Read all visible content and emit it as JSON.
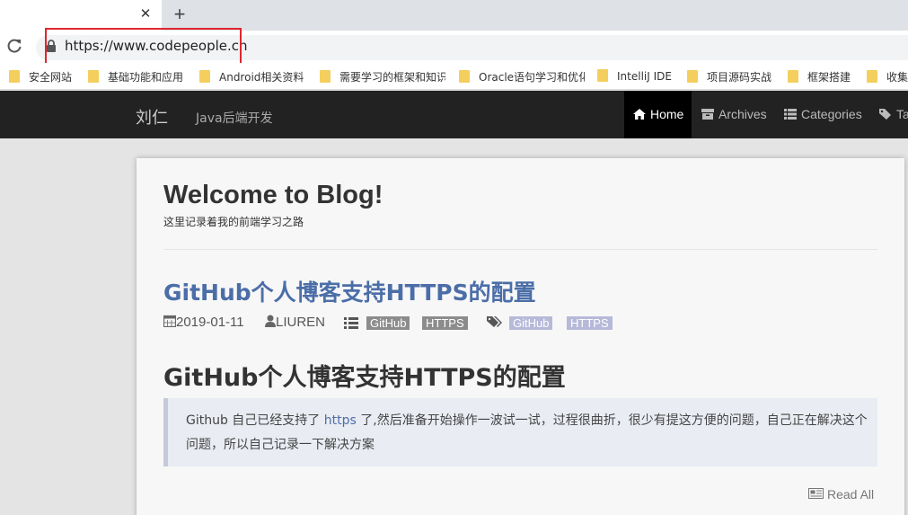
{
  "browser": {
    "tab_close": "✕",
    "new_tab": "+",
    "url": "https://www.codepeople.cn",
    "bookmarks": [
      {
        "label": "安全网站"
      },
      {
        "label": "基础功能和应用"
      },
      {
        "label": "Android相关资料"
      },
      {
        "label": "需要学习的框架和知识"
      },
      {
        "label": "Oracle语句学习和优化"
      },
      {
        "label": "IntelliJ IDE"
      },
      {
        "label": "项目源码实战"
      },
      {
        "label": "框架搭建"
      },
      {
        "label": "收集"
      }
    ]
  },
  "site": {
    "brand": "刘仁",
    "tagline": "Java后端开发",
    "nav": {
      "home": "Home",
      "archives": "Archives",
      "categories": "Categories",
      "tags": "Ta"
    }
  },
  "main": {
    "title": "Welcome to Blog!",
    "subtitle": "这里记录着我的前端学习之路",
    "post": {
      "title": "GitHub个人博客支持HTTPS的配置",
      "date": "2019-01-11",
      "author": "LIUREN",
      "categories": [
        "GitHub",
        "HTTPS"
      ],
      "tags": [
        "GitHub",
        "HTTPS"
      ],
      "heading": "GitHub个人博客支持HTTPS的配置",
      "quote_before": "Github 自己已经支持了 ",
      "quote_link": "https",
      "quote_after": " 了,然后准备开始操作一波试一试，过程很曲折，很少有提这方便的问题，自己正在解决这个问题，所以自己记录一下解决方案",
      "read_all": "Read All"
    }
  },
  "colors": {
    "accent": "#4b6ea8",
    "nav_bg": "#222222",
    "highlight_box": "#e0262e",
    "tag_badge": "#b7b9d9",
    "category_badge": "#8c8c8c"
  },
  "icons": [
    "close-icon",
    "plus-icon",
    "reload-icon",
    "lock-icon",
    "folder-icon",
    "home-icon",
    "archive-icon",
    "list-icon",
    "tag-icon",
    "calendar-icon",
    "user-icon",
    "newspaper-icon"
  ]
}
